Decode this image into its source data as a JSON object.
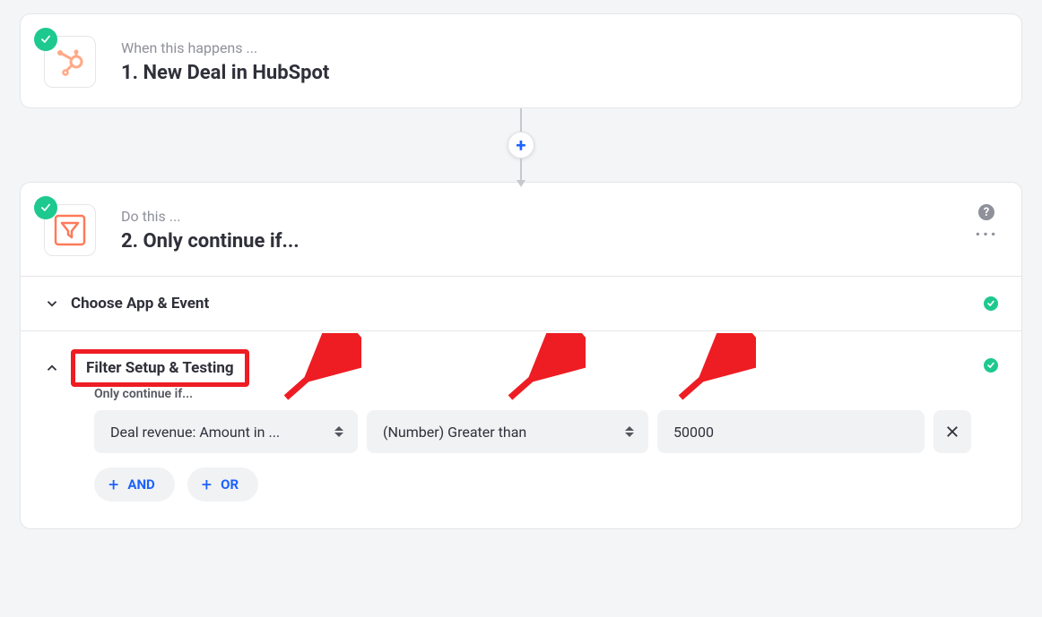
{
  "colors": {
    "accent_orange": "#ff7a59",
    "success_green": "#1dc98e",
    "annotation_red": "#ee1c23",
    "link_blue": "#1b62ff"
  },
  "step1": {
    "subtitle": "When this happens ...",
    "title": "1. New Deal in HubSpot",
    "icon": "hubspot-icon"
  },
  "step2": {
    "subtitle": "Do this ...",
    "title": "2. Only continue if...",
    "icon": "filter-icon"
  },
  "sections": {
    "choose": {
      "label": "Choose App & Event",
      "expanded": false,
      "complete": true
    },
    "filter": {
      "label": "Filter Setup & Testing",
      "expanded": true,
      "complete": true
    }
  },
  "filter": {
    "hint": "Only continue if...",
    "field": "Deal revenue: Amount in ...",
    "condition": "(Number) Greater than",
    "value": "50000",
    "and_label": "AND",
    "or_label": "OR"
  }
}
